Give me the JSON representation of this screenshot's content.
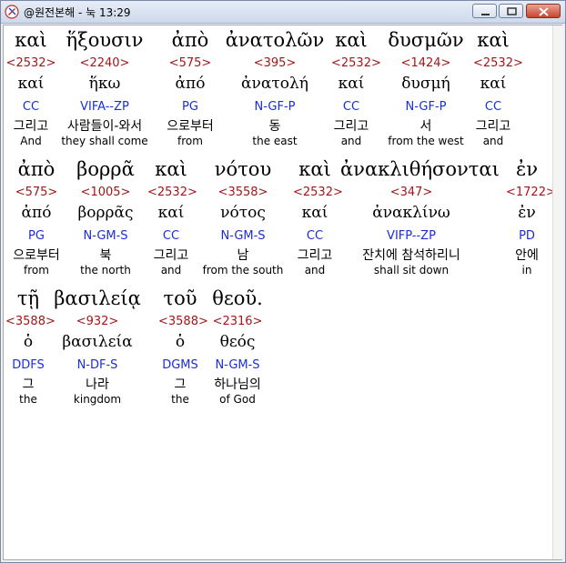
{
  "window": {
    "title": "@원전본해 - 눅 13:29",
    "icon": "book-app-icon"
  },
  "rows": [
    [
      {
        "greek": "καὶ",
        "strong": "<2532>",
        "lemma": "καί",
        "parse": "CC",
        "korean": "그리고",
        "english": "And"
      },
      {
        "greek": "ἥξουσιν",
        "strong": "<2240>",
        "lemma": "ἥκω",
        "parse": "VIFA--ZP",
        "korean": "사람들이-와서",
        "english": "they shall come"
      },
      {
        "greek": "ἀπὸ",
        "strong": "<575>",
        "lemma": "ἀπό",
        "parse": "PG",
        "korean": "으로부터",
        "english": "from"
      },
      {
        "greek": "ἀνατολῶν",
        "strong": "<395>",
        "lemma": "ἀνατολή",
        "parse": "N-GF-P",
        "korean": "동",
        "english": "the east"
      },
      {
        "greek": "καὶ",
        "strong": "<2532>",
        "lemma": "καί",
        "parse": "CC",
        "korean": "그리고",
        "english": "and"
      },
      {
        "greek": "δυσμῶν",
        "strong": "<1424>",
        "lemma": "δυσμή",
        "parse": "N-GF-P",
        "korean": "서",
        "english": "from the west"
      },
      {
        "greek": "καὶ",
        "strong": "<2532>",
        "lemma": "καί",
        "parse": "CC",
        "korean": "그리고",
        "english": "and"
      }
    ],
    [
      {
        "greek": "ἀπὸ",
        "strong": "<575>",
        "lemma": "ἀπό",
        "parse": "PG",
        "korean": "으로부터",
        "english": "from"
      },
      {
        "greek": "βορρᾶ",
        "strong": "<1005>",
        "lemma": "βορρᾶς",
        "parse": "N-GM-S",
        "korean": "북",
        "english": "the north"
      },
      {
        "greek": "καὶ",
        "strong": "<2532>",
        "lemma": "καί",
        "parse": "CC",
        "korean": "그리고",
        "english": "and"
      },
      {
        "greek": "νότου",
        "strong": "<3558>",
        "lemma": "νότος",
        "parse": "N-GM-S",
        "korean": "남",
        "english": "from the south"
      },
      {
        "greek": "καὶ",
        "strong": "<2532>",
        "lemma": "καί",
        "parse": "CC",
        "korean": "그리고",
        "english": "and"
      },
      {
        "greek": "ἀνακλιθήσονται",
        "strong": "<347>",
        "lemma": "ἀνακλίνω",
        "parse": "VIFP--ZP",
        "korean": "잔치에 참석하리니",
        "english": "shall sit down"
      },
      {
        "greek": "ἐν",
        "strong": "<1722>",
        "lemma": "ἐν",
        "parse": "PD",
        "korean": "안에",
        "english": "in"
      }
    ],
    [
      {
        "greek": "τῇ",
        "strong": "<3588>",
        "lemma": "ὁ",
        "parse": "DDFS",
        "korean": "그",
        "english": "the"
      },
      {
        "greek": "βασιλείᾳ",
        "strong": "<932>",
        "lemma": "βασιλεία",
        "parse": "N-DF-S",
        "korean": "나라",
        "english": "kingdom"
      },
      {
        "greek": "τοῦ",
        "strong": "<3588>",
        "lemma": "ὁ",
        "parse": "DGMS",
        "korean": "그",
        "english": "the"
      },
      {
        "greek": "θεοῦ.",
        "strong": "<2316>",
        "lemma": "θεός",
        "parse": "N-GM-S",
        "korean": "하나님의",
        "english": "of God"
      }
    ]
  ]
}
